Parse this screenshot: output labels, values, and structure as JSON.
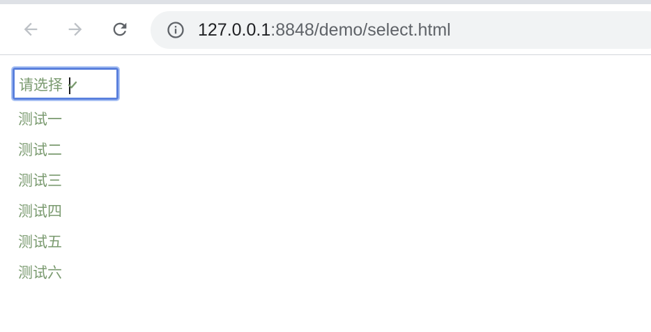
{
  "browser": {
    "url_host": "127.0.0.1",
    "url_rest": ":8848/demo/select.html",
    "icons": {
      "back": "back-arrow-icon",
      "forward": "forward-arrow-icon",
      "reload": "reload-icon",
      "site_info": "info-icon"
    }
  },
  "page": {
    "select": {
      "placeholder": "请选择",
      "options": [
        "测试一",
        "测试二",
        "测试三",
        "测试四",
        "测试五",
        "测试六"
      ]
    },
    "colors": {
      "text": "#7a9a6f",
      "focus_border": "#5a80dd",
      "focus_ring": "#a9c1f3"
    }
  }
}
